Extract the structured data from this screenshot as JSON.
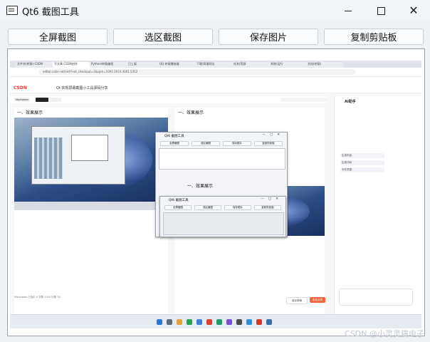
{
  "window": {
    "title": "Qt6 截图工具"
  },
  "toolbar": {
    "fullscreen_label": "全屏截图",
    "region_label": "选区截图",
    "save_label": "保存图片",
    "copy_label": "复制剪贴板"
  },
  "preview": {
    "browser_tabs": [
      "文件夹(转载)-CSDN",
      "写文章-CSDN创作",
      "Python/转载编程",
      "已上架",
      "QQ 转载播放器",
      "下载/高速网址",
      "任务/资源",
      "系统/运行",
      "文档(转载)"
    ],
    "url": "editor.csdn.net/md/?not_checkout=1&spm=1001.2014.3001.5352",
    "csdn_logo": "CSDN",
    "article_title": "Qt 实现屏幕截图小工具源码分享",
    "editor_mode": "Markdown",
    "editor_heading_left": "一、效果展示",
    "editor_heading_right": "一、效果展示",
    "ai_title": "AI助手",
    "ai_buttons": [
      "生成内容",
      "生成代码",
      "写作灵感"
    ],
    "status_text": "Markdown 已选中 0 字数 1343 行数 30",
    "save_draft": "保存草稿",
    "publish": "发布文章",
    "inner_window_title": "Qt6 截图工具",
    "inner_buttons": [
      "全屏截图",
      "选区截图",
      "保存图片",
      "复制剪贴板"
    ]
  },
  "watermark": "CSDN @小灵灵搞电子"
}
